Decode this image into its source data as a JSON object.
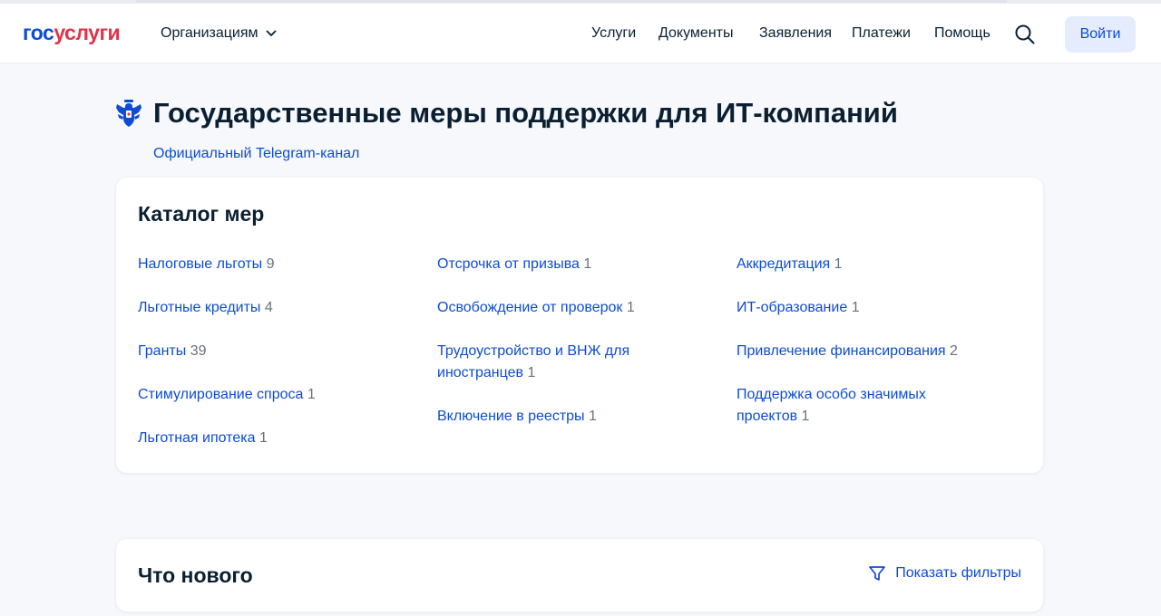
{
  "header": {
    "logo_part1": "гос",
    "logo_part2": "услуги",
    "organizations": "Организациям",
    "nav": [
      "Услуги",
      "Документы",
      "Заявления",
      "Платежи",
      "Помощь"
    ],
    "login": "Войти"
  },
  "page": {
    "title": "Государственные меры поддержки для ИТ-компаний",
    "telegram_link": "Официальный Telegram-канал"
  },
  "catalog": {
    "title": "Каталог мер",
    "columns": [
      [
        {
          "label": "Налоговые льготы",
          "count": "9"
        },
        {
          "label": "Льготные кредиты",
          "count": "4"
        },
        {
          "label": "Гранты",
          "count": "39"
        },
        {
          "label": "Стимулирование спроса",
          "count": "1"
        },
        {
          "label": "Льготная ипотека",
          "count": "1"
        }
      ],
      [
        {
          "label": "Отсрочка от призыва",
          "count": "1"
        },
        {
          "label": "Освобождение от проверок",
          "count": "1"
        },
        {
          "label": "Трудоустройство и ВНЖ для иностранцев",
          "count": "1"
        },
        {
          "label": "Включение в реестры",
          "count": "1"
        }
      ],
      [
        {
          "label": "Аккредитация",
          "count": "1"
        },
        {
          "label": "ИТ-образование",
          "count": "1"
        },
        {
          "label": "Привлечение финансирования",
          "count": "2"
        },
        {
          "label": "Поддержка особо значимых проектов",
          "count": "1"
        }
      ]
    ]
  },
  "news": {
    "title": "Что нового",
    "filters": "Показать фильтры"
  },
  "icons": {
    "emblem": "coat-of-arms-icon",
    "search": "search-icon",
    "chevron": "chevron-down-icon",
    "filter": "filter-icon"
  },
  "colors": {
    "brand_blue": "#0d4cd3",
    "brand_red": "#e0334c",
    "text": "#0b1f33",
    "muted": "#66727f",
    "background": "#f6f8fc"
  }
}
